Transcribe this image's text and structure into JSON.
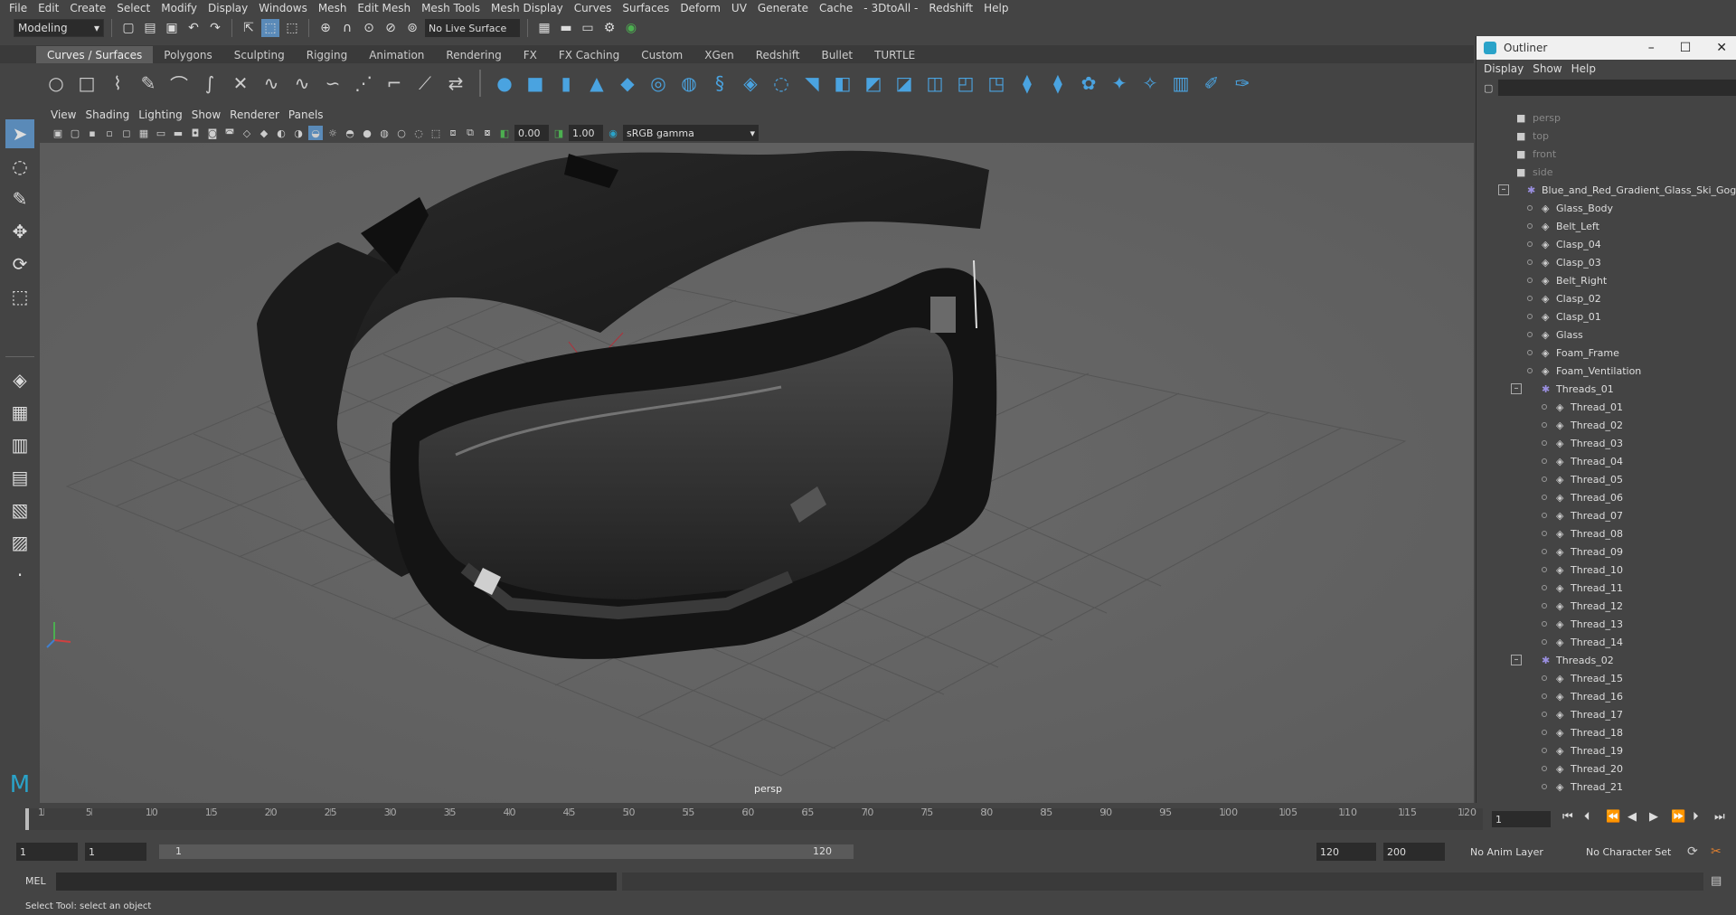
{
  "menubar": [
    "File",
    "Edit",
    "Create",
    "Select",
    "Modify",
    "Display",
    "Windows",
    "Mesh",
    "Edit Mesh",
    "Mesh Tools",
    "Mesh Display",
    "Curves",
    "Surfaces",
    "Deform",
    "UV",
    "Generate",
    "Cache",
    "- 3DtoAll -",
    "Redshift",
    "Help"
  ],
  "statusline": {
    "mode": "Modeling",
    "live_surface": "No Live Surface"
  },
  "shelf_tabs": [
    "Curves / Surfaces",
    "Polygons",
    "Sculpting",
    "Rigging",
    "Animation",
    "Rendering",
    "FX",
    "FX Caching",
    "Custom",
    "XGen",
    "Redshift",
    "Bullet",
    "TURTLE"
  ],
  "active_shelf_tab": "Curves / Surfaces",
  "viewport": {
    "menu": [
      "View",
      "Shading",
      "Lighting",
      "Show",
      "Renderer",
      "Panels"
    ],
    "exposure": "0.00",
    "gamma_value": "1.00",
    "color_space": "sRGB gamma",
    "camera_label": "persp"
  },
  "outliner": {
    "title": "Outliner",
    "menu": [
      "Display",
      "Show",
      "Help"
    ],
    "rows": [
      {
        "name": "persp",
        "level": 0,
        "type": "camera",
        "dim": true
      },
      {
        "name": "top",
        "level": 0,
        "type": "camera",
        "dim": true
      },
      {
        "name": "front",
        "level": 0,
        "type": "camera",
        "dim": true
      },
      {
        "name": "side",
        "level": 0,
        "type": "camera",
        "dim": true
      },
      {
        "name": "Blue_and_Red_Gradient_Glass_Ski_Goggles",
        "level": 0,
        "type": "group",
        "expanded": true
      },
      {
        "name": "Glass_Body",
        "level": 1,
        "type": "mesh"
      },
      {
        "name": "Belt_Left",
        "level": 1,
        "type": "mesh"
      },
      {
        "name": "Clasp_04",
        "level": 1,
        "type": "mesh"
      },
      {
        "name": "Clasp_03",
        "level": 1,
        "type": "mesh"
      },
      {
        "name": "Belt_Right",
        "level": 1,
        "type": "mesh"
      },
      {
        "name": "Clasp_02",
        "level": 1,
        "type": "mesh"
      },
      {
        "name": "Clasp_01",
        "level": 1,
        "type": "mesh"
      },
      {
        "name": "Glass",
        "level": 1,
        "type": "mesh"
      },
      {
        "name": "Foam_Frame",
        "level": 1,
        "type": "mesh"
      },
      {
        "name": "Foam_Ventilation",
        "level": 1,
        "type": "mesh"
      },
      {
        "name": "Threads_01",
        "level": 1,
        "type": "group",
        "expanded": true
      },
      {
        "name": "Thread_01",
        "level": 2,
        "type": "mesh"
      },
      {
        "name": "Thread_02",
        "level": 2,
        "type": "mesh"
      },
      {
        "name": "Thread_03",
        "level": 2,
        "type": "mesh"
      },
      {
        "name": "Thread_04",
        "level": 2,
        "type": "mesh"
      },
      {
        "name": "Thread_05",
        "level": 2,
        "type": "mesh"
      },
      {
        "name": "Thread_06",
        "level": 2,
        "type": "mesh"
      },
      {
        "name": "Thread_07",
        "level": 2,
        "type": "mesh"
      },
      {
        "name": "Thread_08",
        "level": 2,
        "type": "mesh"
      },
      {
        "name": "Thread_09",
        "level": 2,
        "type": "mesh"
      },
      {
        "name": "Thread_10",
        "level": 2,
        "type": "mesh"
      },
      {
        "name": "Thread_11",
        "level": 2,
        "type": "mesh"
      },
      {
        "name": "Thread_12",
        "level": 2,
        "type": "mesh"
      },
      {
        "name": "Thread_13",
        "level": 2,
        "type": "mesh"
      },
      {
        "name": "Thread_14",
        "level": 2,
        "type": "mesh"
      },
      {
        "name": "Threads_02",
        "level": 1,
        "type": "group",
        "expanded": true
      },
      {
        "name": "Thread_15",
        "level": 2,
        "type": "mesh"
      },
      {
        "name": "Thread_16",
        "level": 2,
        "type": "mesh"
      },
      {
        "name": "Thread_17",
        "level": 2,
        "type": "mesh"
      },
      {
        "name": "Thread_18",
        "level": 2,
        "type": "mesh"
      },
      {
        "name": "Thread_19",
        "level": 2,
        "type": "mesh"
      },
      {
        "name": "Thread_20",
        "level": 2,
        "type": "mesh"
      },
      {
        "name": "Thread_21",
        "level": 2,
        "type": "mesh"
      }
    ]
  },
  "timeslider": {
    "ticks": [
      "1",
      "5",
      "10",
      "15",
      "20",
      "25",
      "30",
      "35",
      "40",
      "45",
      "50",
      "55",
      "60",
      "65",
      "70",
      "75",
      "80",
      "85",
      "90",
      "95",
      "100",
      "105",
      "110",
      "115",
      "120"
    ],
    "current_frame": "1"
  },
  "range": {
    "start": "1",
    "anim_start": "1",
    "slider_start": "1",
    "slider_end": "120",
    "end": "120",
    "anim_end": "200",
    "anim_layer": "No Anim Layer",
    "character_set": "No Character Set"
  },
  "cmd": {
    "label": "MEL"
  },
  "helpline": "Select Tool: select an object",
  "colors": {
    "accent": "#5a8ab8",
    "maya_logo": "#2aa3c9"
  }
}
